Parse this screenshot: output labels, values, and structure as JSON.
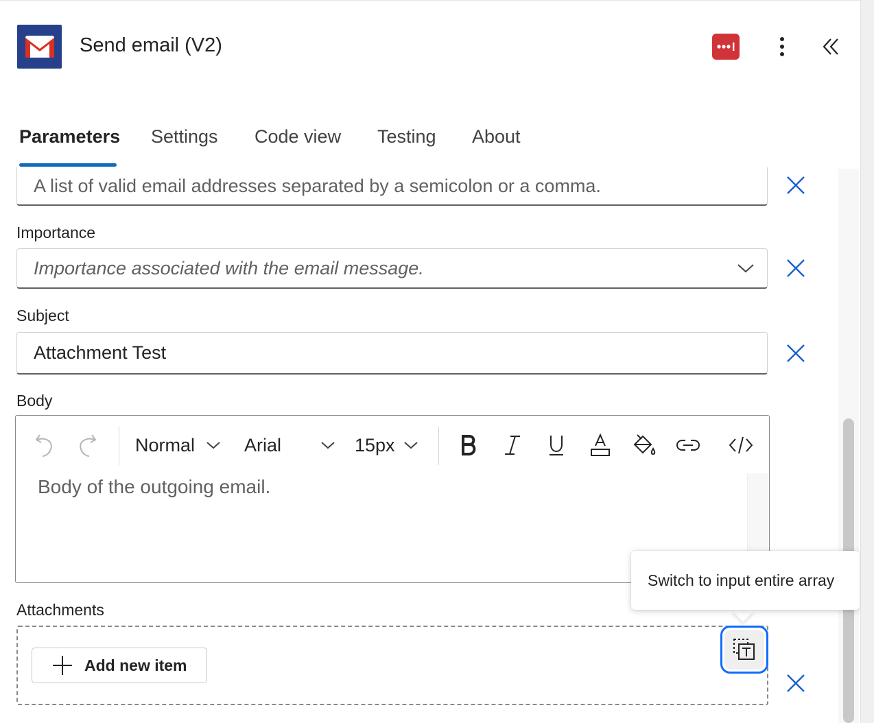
{
  "header": {
    "title": "Send email (V2)",
    "logo_icon": "gmail-icon",
    "status_icon": "ellipsis-status-icon",
    "status_color": "#d13438"
  },
  "tabs": [
    {
      "label": "Parameters",
      "active": true
    },
    {
      "label": "Settings",
      "active": false
    },
    {
      "label": "Code view",
      "active": false
    },
    {
      "label": "Testing",
      "active": false
    },
    {
      "label": "About",
      "active": false
    }
  ],
  "fields": {
    "bcc": {
      "placeholder": "A list of valid email addresses separated by a semicolon or a comma."
    },
    "importance": {
      "label": "Importance",
      "placeholder": "Importance associated with the email message."
    },
    "subject": {
      "label": "Subject",
      "value": "Attachment Test"
    },
    "body": {
      "label": "Body",
      "placeholder": "Body of the outgoing email.",
      "toolbar": {
        "paragraph_style": "Normal",
        "font": "Arial",
        "size": "15px"
      }
    },
    "attachments": {
      "label": "Attachments",
      "add_label": "Add new item"
    }
  },
  "tooltip": {
    "text": "Switch to input entire array"
  },
  "colors": {
    "accent": "#0f6cbd",
    "clear_icon": "#1a5fd0",
    "focus_ring": "#0f6cfd"
  }
}
